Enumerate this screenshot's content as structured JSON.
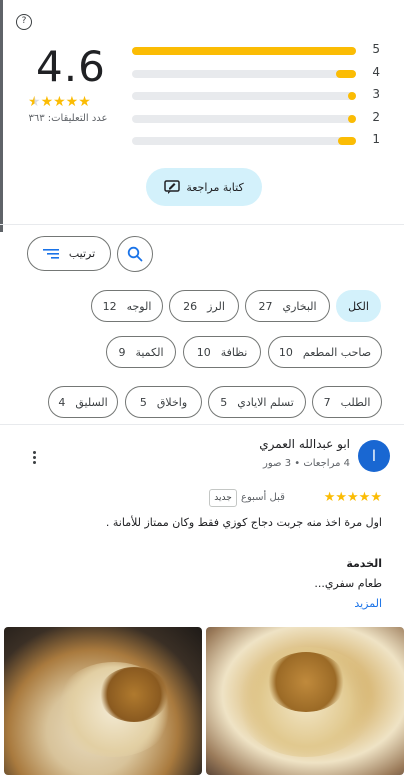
{
  "summary": {
    "help_glyph": "?",
    "score": "4.6",
    "stars": "★★★★★",
    "count_label": "عدد التعليقات: ٣٦٣"
  },
  "histogram": [
    {
      "label": "5",
      "fill": 1.0
    },
    {
      "label": "4",
      "fill": 0.09
    },
    {
      "label": "3",
      "fill": 0.02
    },
    {
      "label": "2",
      "fill": 0.02
    },
    {
      "label": "1",
      "fill": 0.08
    }
  ],
  "write_review": {
    "label": "كتابة مراجعة"
  },
  "toolbar": {
    "sort_label": "ترتيب"
  },
  "chips": [
    {
      "label": "الكل",
      "count": ""
    },
    {
      "label": "البخاري",
      "count": "27"
    },
    {
      "label": "الرز",
      "count": "26"
    },
    {
      "label": "الوجه",
      "count": "12"
    },
    {
      "label": "صاحب المطعم",
      "count": "10"
    },
    {
      "label": "نظافة",
      "count": "10"
    },
    {
      "label": "الكمية",
      "count": "9"
    },
    {
      "label": "الطلب",
      "count": "7"
    },
    {
      "label": "تسلم الايادي",
      "count": "5"
    },
    {
      "label": "واخلاق",
      "count": "5"
    },
    {
      "label": "السليق",
      "count": "4"
    }
  ],
  "review": {
    "avatar_letter": "ا",
    "author": "ابو عبدالله العمري",
    "meta": "4 مراجعات • 3 صور",
    "stars": "★★★★★",
    "time": "قبل أسبوع",
    "badge": "جديد",
    "text": "اول مرة اخذ منه جربت دجاج كوزي فقط وكان ممتاز للأمانة .",
    "section_label": "الخدمة",
    "section_value": "طعام سفري...",
    "more_label": "المزيد"
  },
  "colors": {
    "star": "#fbbc04",
    "accent_chip": "#d3f1fb",
    "avatar": "#1967d2",
    "link": "#1a73e8"
  }
}
